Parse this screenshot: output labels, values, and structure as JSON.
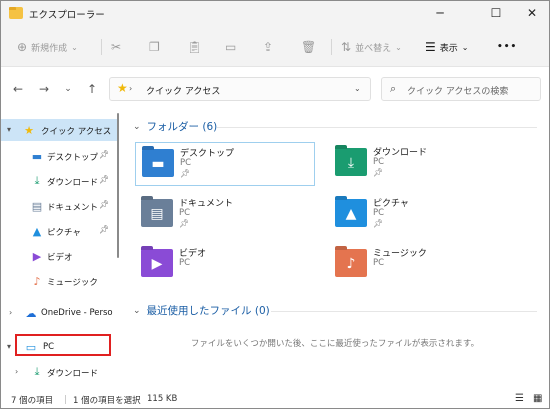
{
  "window": {
    "title": "エクスプローラー",
    "minimize_icon": "─",
    "maximize_icon": "☐",
    "close_icon": "✕"
  },
  "toolbar": {
    "new_label": "新規作成",
    "sort_label": "並べ替え",
    "view_label": "表示",
    "more_icon": "•••"
  },
  "address": {
    "path_label": "クイック アクセス",
    "search_placeholder": "クイック アクセスの検索"
  },
  "sidebar": {
    "items": [
      {
        "label": "クイック アクセス"
      },
      {
        "label": "デスクトップ"
      },
      {
        "label": "ダウンロード"
      },
      {
        "label": "ドキュメント"
      },
      {
        "label": "ピクチャ"
      },
      {
        "label": "ビデオ"
      },
      {
        "label": "ミュージック"
      },
      {
        "label": "OneDrive - Perso"
      },
      {
        "label": "PC"
      },
      {
        "label": "ダウンロード"
      }
    ]
  },
  "content": {
    "folders_header": "フォルダー (6)",
    "folders": [
      {
        "name": "デスクトップ",
        "location": "PC",
        "color": "#2f7fd1"
      },
      {
        "name": "ダウンロード",
        "location": "PC",
        "color": "#1a9c70"
      },
      {
        "name": "ドキュメント",
        "location": "PC",
        "color": "#6a7f99"
      },
      {
        "name": "ピクチャ",
        "location": "PC",
        "color": "#1f8fde"
      },
      {
        "name": "ビデオ",
        "location": "PC",
        "color": "#8a4bd6"
      },
      {
        "name": "ミュージック",
        "location": "PC",
        "color": "#e4744f"
      }
    ],
    "recent_header": "最近使用したファイル (0)",
    "empty_message": "ファイルをいくつか開いた後、ここに最近使ったファイルが表示されます。"
  },
  "status": {
    "item_count": "7 個の項目",
    "selected": "1 個の項目を選択",
    "size": "115 KB"
  }
}
